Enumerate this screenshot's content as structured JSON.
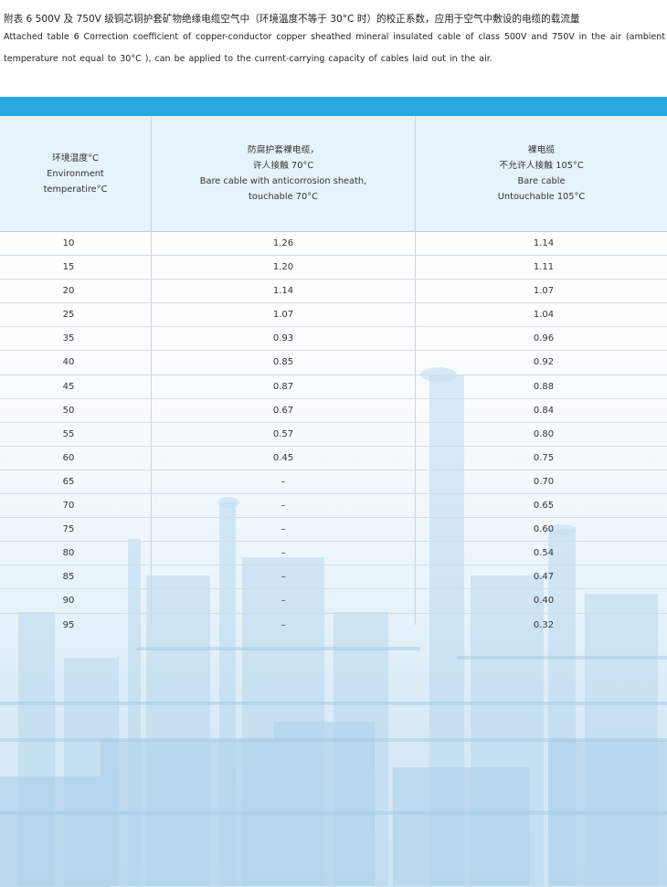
{
  "header": {
    "title_cn": "附表 6  500V 及 750V 级铜芯铜护套矿物绝缘电缆空气中（环境温度不等于 30°C 时）的校正系数，应用于空气中敷设的电缆的载流量",
    "title_en": "Attached table 6 Correction coefficient of copper-conductor copper sheathed mineral insulated cable of class 500V and 750V in the air (ambient temperature not equal to 30°C ), can be applied to the current-carrying capacity of cables laid out in the air."
  },
  "table": {
    "headers": {
      "temperature": {
        "cn": "环境温度°C",
        "en1": "Environment",
        "en2": "temperatire°C"
      },
      "touchable": {
        "cn1": "防腐护套裸电缆，",
        "cn2": "许人接触 70°C",
        "en1": "Bare cable with anticorrosion sheath,",
        "en2": "touchable 70°C"
      },
      "untouchable": {
        "cn1": "裸电缆",
        "cn2": "不允许人接触 105°C",
        "en1": "Bare cable",
        "en2": "Untouchable 105°C"
      }
    },
    "rows": [
      {
        "temp": "10",
        "touchable": "1.26",
        "untouchable": "1.14"
      },
      {
        "temp": "15",
        "touchable": "1.20",
        "untouchable": "1.11"
      },
      {
        "temp": "20",
        "touchable": "1.14",
        "untouchable": "1.07"
      },
      {
        "temp": "25",
        "touchable": "1.07",
        "untouchable": "1.04"
      },
      {
        "temp": "35",
        "touchable": "0.93",
        "untouchable": "0.96"
      },
      {
        "temp": "40",
        "touchable": "0.85",
        "untouchable": "0.92"
      },
      {
        "temp": "45",
        "touchable": "0.87",
        "untouchable": "0.88"
      },
      {
        "temp": "50",
        "touchable": "0.67",
        "untouchable": "0.84"
      },
      {
        "temp": "55",
        "touchable": "0.57",
        "untouchable": "0.80"
      },
      {
        "temp": "60",
        "touchable": "0.45",
        "untouchable": "0.75"
      },
      {
        "temp": "65",
        "touchable": "–",
        "untouchable": "0.70"
      },
      {
        "temp": "70",
        "touchable": "–",
        "untouchable": "0.65"
      },
      {
        "temp": "75",
        "touchable": "–",
        "untouchable": "0.60"
      },
      {
        "temp": "80",
        "touchable": "–",
        "untouchable": "0.54"
      },
      {
        "temp": "85",
        "touchable": "–",
        "untouchable": "0.47"
      },
      {
        "temp": "90",
        "touchable": "–",
        "untouchable": "0.40"
      },
      {
        "temp": "95",
        "touchable": "–",
        "untouchable": "0.32"
      }
    ]
  },
  "colors": {
    "band": "#29a7e1",
    "header_bg": "#e7f3fb",
    "background_tint": "#cde5f4"
  }
}
